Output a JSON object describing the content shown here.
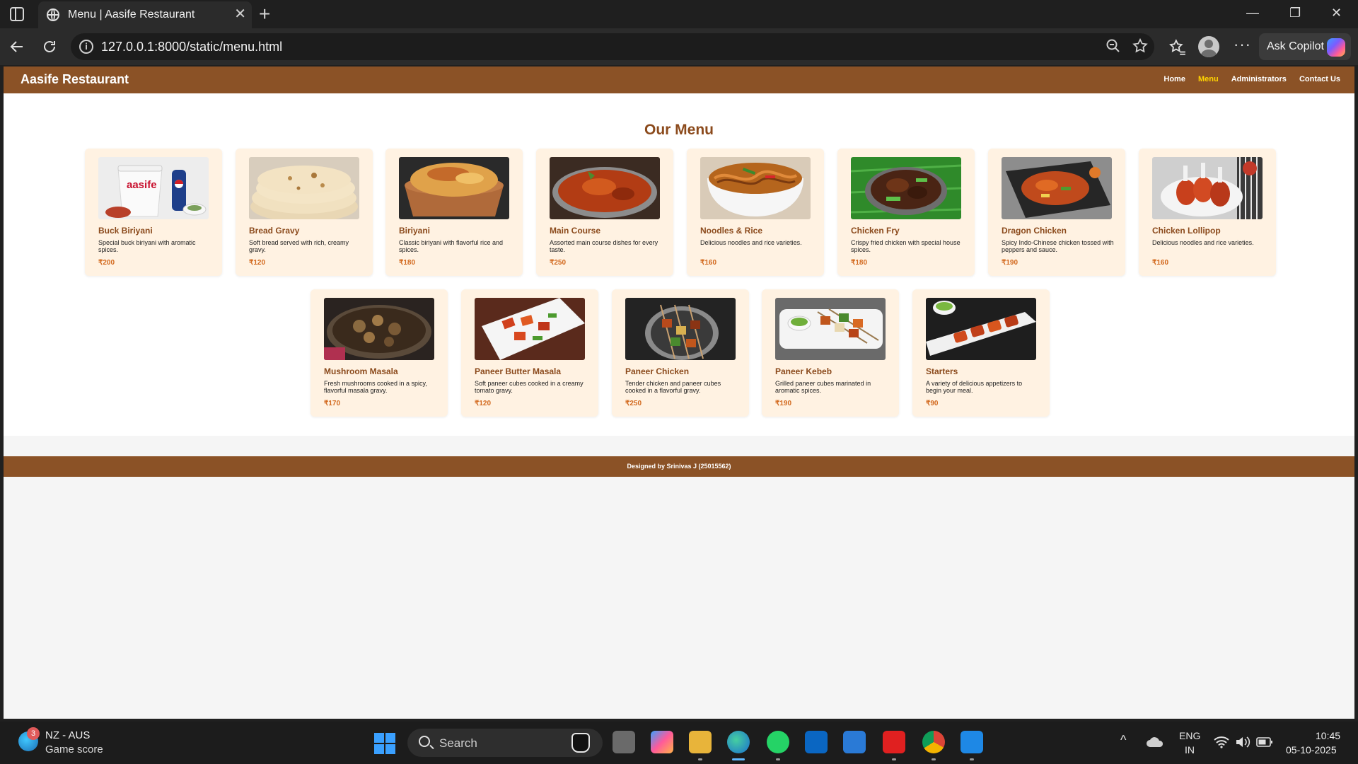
{
  "browser": {
    "tab_title": "Menu | Aasife Restaurant",
    "tab_close": "✕",
    "new_tab": "+",
    "url": "127.0.0.1:8000/static/menu.html",
    "copilot_label": "Ask Copilot",
    "minimize": "—",
    "maximize": "❐",
    "close": "✕"
  },
  "site": {
    "brand": "Aasife Restaurant",
    "nav": [
      "Home",
      "Menu",
      "Administrators",
      "Contact Us"
    ],
    "active_nav": "Menu",
    "page_title": "Our Menu",
    "footer": "Designed by Srinivas J (25015562)"
  },
  "menu_items": [
    {
      "name": "Buck Biriyani",
      "desc": "Special buck biriyani with aromatic spices.",
      "price": "₹200",
      "image": "biriyani-bucket-with-pepsi"
    },
    {
      "name": "Bread Gravy",
      "desc": "Soft bread served with rich, creamy gravy.",
      "price": "₹120",
      "image": "flatbread-stack"
    },
    {
      "name": "Biriyani",
      "desc": "Classic biriyani with flavorful rice and spices.",
      "price": "₹180",
      "image": "biriyani-in-copper-pot"
    },
    {
      "name": "Main Course",
      "desc": "Assorted main course dishes for every taste.",
      "price": "₹250",
      "image": "curry-bowl"
    },
    {
      "name": "Noodles & Rice",
      "desc": "Delicious noodles and rice varieties.",
      "price": "₹160",
      "image": "noodles-bowl"
    },
    {
      "name": "Chicken Fry",
      "desc": "Crispy fried chicken with special house spices.",
      "price": "₹180",
      "image": "chicken-fry-on-banana-leaf"
    },
    {
      "name": "Dragon Chicken",
      "desc": "Spicy Indo-Chinese chicken tossed with peppers and sauce.",
      "price": "₹190",
      "image": "dragon-chicken-plate"
    },
    {
      "name": "Chicken Lollipop",
      "desc": "Delicious noodles and rice varieties.",
      "price": "₹160",
      "image": "chicken-lollipops"
    },
    {
      "name": "Mushroom Masala",
      "desc": "Fresh mushrooms cooked in a spicy, flavorful masala gravy.",
      "price": "₹170",
      "image": "mushroom-masala"
    },
    {
      "name": "Paneer Butter Masala",
      "desc": "Soft paneer cubes cooked in a creamy tomato gravy.",
      "price": "₹120",
      "image": "paneer-chilli-plate"
    },
    {
      "name": "Paneer Chicken",
      "desc": "Tender chicken and paneer cubes cooked in a flavorful gravy.",
      "price": "₹250",
      "image": "skewers-on-plate"
    },
    {
      "name": "Paneer Kebeb",
      "desc": "Grilled paneer cubes marinated in aromatic spices.",
      "price": "₹190",
      "image": "paneer-kebab-tray"
    },
    {
      "name": "Starters",
      "desc": "A variety of delicious appetizers to begin your meal.",
      "price": "₹90",
      "image": "tikka-on-slate"
    }
  ],
  "taskbar": {
    "news_badge": "3",
    "news_line1": "NZ - AUS",
    "news_line2": "Game score",
    "search_label": "Search",
    "lang_line1": "ENG",
    "lang_line2": "IN",
    "time": "10:45",
    "date": "05-10-2025",
    "tray_chevron": "^"
  },
  "colors": {
    "header_brown": "#8b5226",
    "active_nav": "#ffd400",
    "card_bg": "#fff2e2",
    "item_name": "#8b4a1c",
    "price": "#d2691e"
  }
}
